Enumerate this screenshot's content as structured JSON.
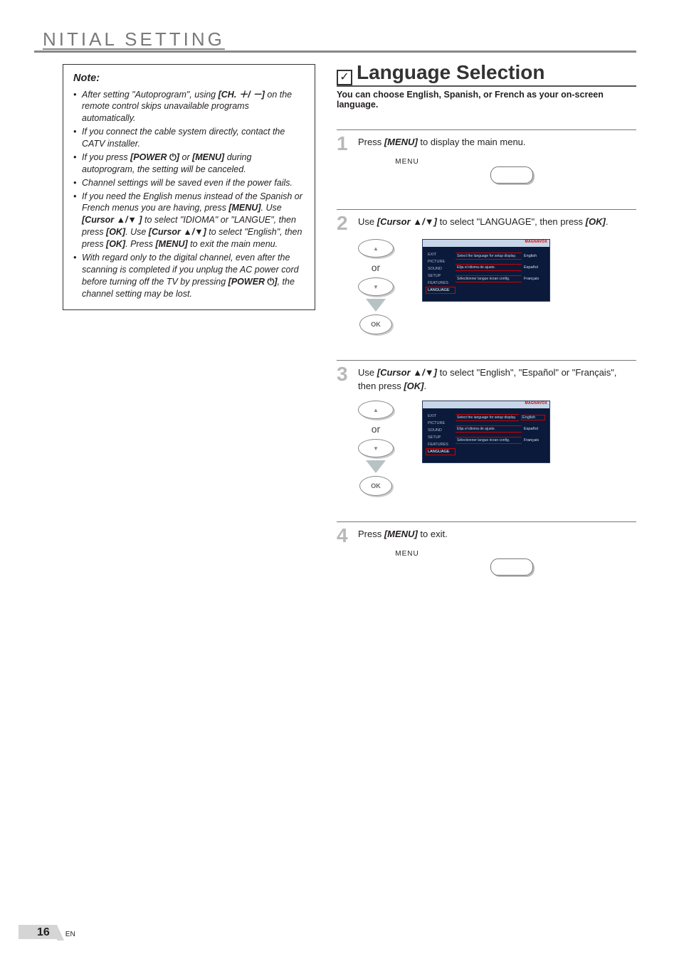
{
  "header": {
    "title": "NITIAL SETTING"
  },
  "note": {
    "title": "Note:",
    "items": [
      {
        "parts": [
          "After setting \"Autoprogram\", using ",
          {
            "b": "[CH. ＋/ －]"
          },
          " on the remote control skips unavailable programs automatically."
        ]
      },
      {
        "parts": [
          "If you connect the cable system directly, contact the CATV installer."
        ]
      },
      {
        "parts": [
          "If you press ",
          {
            "b": "[POWER 🔆]"
          },
          " or ",
          {
            "b": "[MENU]"
          },
          " during autoprogram, the setting will be canceled."
        ]
      },
      {
        "parts": [
          "Channel settings will be saved even if the power fails."
        ]
      },
      {
        "parts": [
          "If you need the English menus instead of the Spanish or French menus you are having, press ",
          {
            "b": "[MENU]"
          },
          ". Use ",
          {
            "b": "[Cursor ▲/▼ ]"
          },
          " to select \"IDIOMA\" or \"LANGUE\", then press ",
          {
            "b": "[OK]"
          },
          ". Use ",
          {
            "b": "[Cursor ▲/▼]"
          },
          " to select \"English\", then press ",
          {
            "b": "[OK]"
          },
          ". Press ",
          {
            "b": "[MENU]"
          },
          " to exit the main menu."
        ]
      },
      {
        "parts": [
          "With regard only to the digital channel, even after the scanning is completed if you unplug the AC power cord before turning off the TV by pressing ",
          {
            "b": "[POWER 🔆]"
          },
          ", the channel setting may be lost."
        ]
      }
    ]
  },
  "section": {
    "title": "Language Selection",
    "subtitle": "You can choose English, Spanish, or French as your on-screen language."
  },
  "steps": [
    {
      "num": "1",
      "parts": [
        "Press ",
        {
          "b": "[MENU]"
        },
        " to display the main menu."
      ]
    },
    {
      "num": "2",
      "parts": [
        "Use ",
        {
          "b": "[Cursor ▲/▼]"
        },
        " to select \"LANGUAGE\", then press ",
        {
          "b": "[OK]"
        },
        "."
      ]
    },
    {
      "num": "3",
      "parts": [
        "Use ",
        {
          "b": "[Cursor ▲/▼]"
        },
        " to select \"English\", \"Español\" or \"Français\", then press ",
        {
          "b": "[OK]"
        },
        "."
      ]
    },
    {
      "num": "4",
      "parts": [
        "Press ",
        {
          "b": "[MENU]"
        },
        " to exit."
      ]
    }
  ],
  "remote": {
    "menu_label": "MENU",
    "or": "or",
    "ok": "OK"
  },
  "osd": {
    "brand": "MAGNAVOX",
    "menu": [
      "EXIT",
      "PICTURE",
      "SOUND",
      "SETUP",
      "FEATURES",
      "LANGUAGE"
    ],
    "lines": [
      "Select the language for setup display.",
      "Elija el idioma de ajuste.",
      "Sélectionner langue écran config."
    ],
    "langs": [
      "English",
      "Español",
      "Français"
    ]
  },
  "footer": {
    "page_num": "16",
    "lang": "EN"
  }
}
